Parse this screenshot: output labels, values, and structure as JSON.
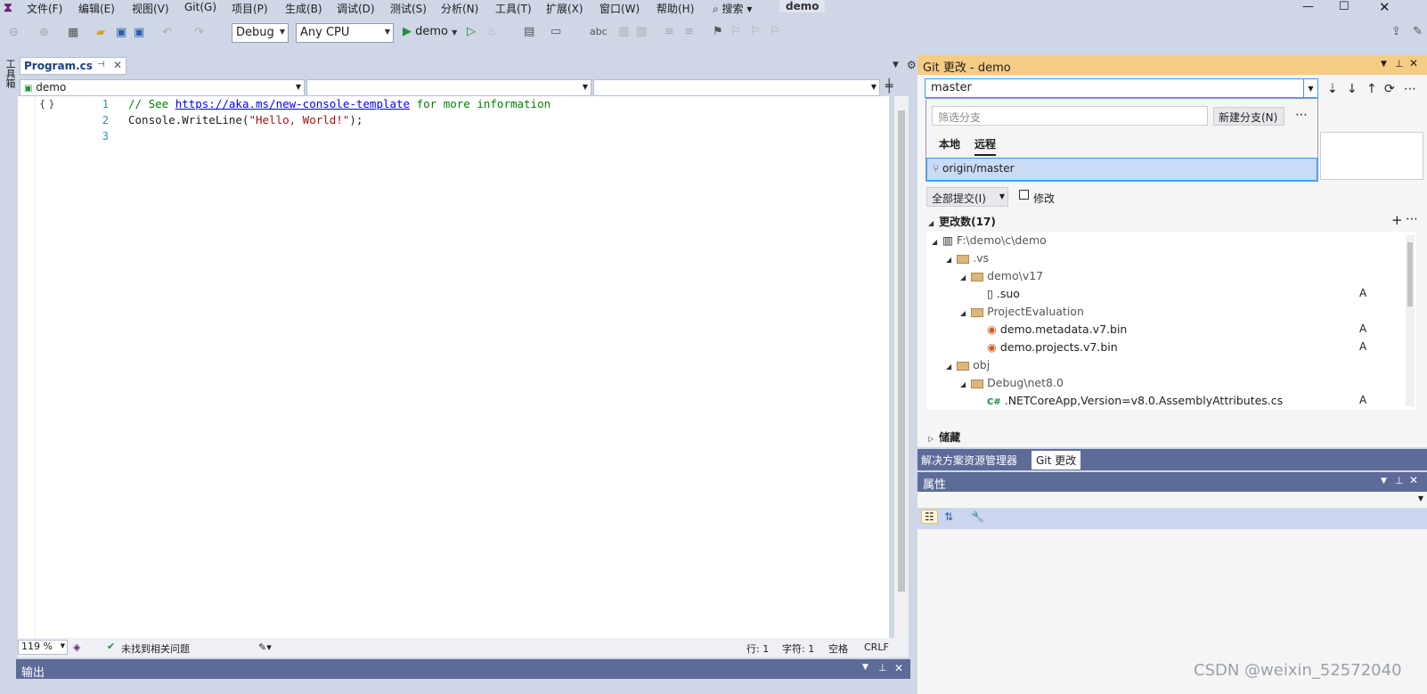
{
  "menu": [
    "文件(F)",
    "编辑(E)",
    "视图(V)",
    "Git(G)",
    "项目(P)",
    "生成(B)",
    "调试(D)",
    "测试(S)",
    "分析(N)",
    "工具(T)",
    "扩展(X)",
    "窗口(W)",
    "帮助(H)"
  ],
  "search": "搜索",
  "solution_name": "demo",
  "toolbar": {
    "config": "Debug",
    "platform": "Any CPU",
    "run_label": "demo"
  },
  "left_strip": "工具箱",
  "editor": {
    "tab": "Program.cs",
    "nav": [
      "demo",
      "",
      ""
    ],
    "lines": [
      {
        "no": "1",
        "comment_pre": "// See ",
        "link": "https://aka.ms/new-console-template",
        "comment_post": " for more information"
      },
      {
        "no": "2",
        "code_a": "Console.WriteLine(",
        "code_str": "\"Hello, World!\"",
        "code_b": ");"
      },
      {
        "no": "3"
      }
    ]
  },
  "status": {
    "zoom": "119 %",
    "issues": "未找到相关问题",
    "line": "行: 1",
    "col": "字符: 1",
    "space": "空格",
    "eol": "CRLF"
  },
  "output_title": "输出",
  "git": {
    "title": "Git 更改 - demo",
    "branch": "master",
    "filter_placeholder": "筛选分支",
    "new_branch": "新建分支(N)",
    "tab_local": "本地",
    "tab_remote": "远程",
    "remote_branch": "origin/master",
    "commit_all": "全部提交(I)",
    "amend": "修改",
    "changes": "更改数(17)",
    "stash": "储藏",
    "tree": [
      {
        "label": "F:\\demo\\c\\demo",
        "indent": 0,
        "kind": "root",
        "status": ""
      },
      {
        "label": ".vs",
        "indent": 1,
        "kind": "folder",
        "status": ""
      },
      {
        "label": "demo\\v17",
        "indent": 2,
        "kind": "folder",
        "status": ""
      },
      {
        "label": ".suo",
        "indent": 3,
        "kind": "file",
        "status": "A"
      },
      {
        "label": "ProjectEvaluation",
        "indent": 2,
        "kind": "folder",
        "status": ""
      },
      {
        "label": "demo.metadata.v7.bin",
        "indent": 3,
        "kind": "bin",
        "status": "A"
      },
      {
        "label": "demo.projects.v7.bin",
        "indent": 3,
        "kind": "bin",
        "status": "A"
      },
      {
        "label": "obj",
        "indent": 1,
        "kind": "folder",
        "status": ""
      },
      {
        "label": "Debug\\net8.0",
        "indent": 2,
        "kind": "folder",
        "status": ""
      },
      {
        "label": ".NETCoreApp,Version=v8.0.AssemblyAttributes.cs",
        "indent": 3,
        "kind": "cs",
        "status": "A"
      }
    ]
  },
  "bottom_tabs": [
    "解决方案资源管理器",
    "Git 更改"
  ],
  "properties_title": "属性",
  "watermark": "CSDN @weixin_52572040"
}
